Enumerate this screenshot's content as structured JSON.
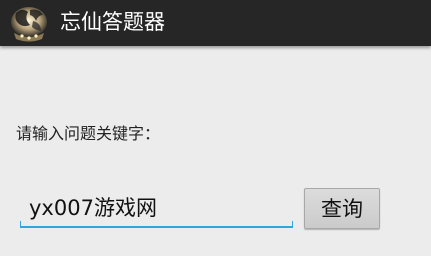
{
  "app": {
    "title": "忘仙答题器",
    "icon": "game-logo-icon",
    "colors": {
      "action_bar_bg": "#262626",
      "content_bg": "#ececec",
      "accent_underline": "#33a5d8",
      "button_bg": "#d4d4d4"
    }
  },
  "form": {
    "prompt_label": "请输入问题关键字：",
    "keyword_input": {
      "value": "yx007游戏网",
      "placeholder": ""
    },
    "query_button_label": "查询"
  }
}
